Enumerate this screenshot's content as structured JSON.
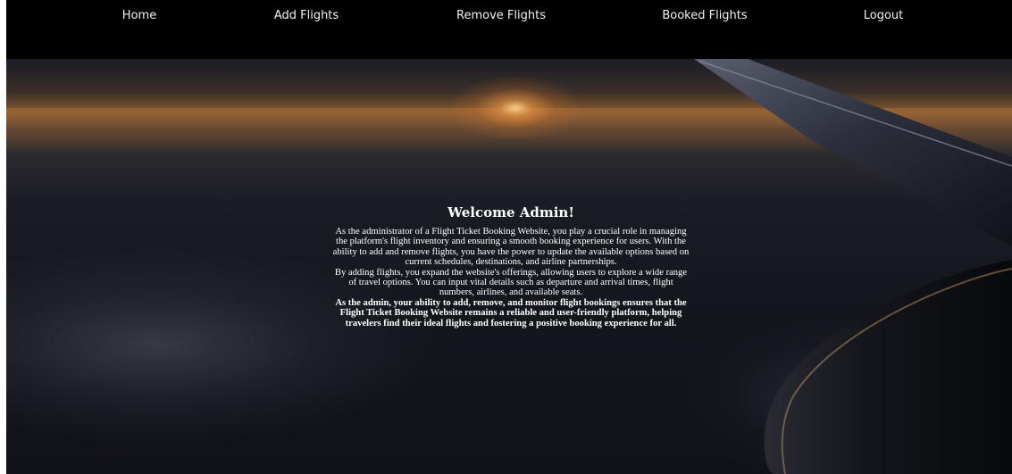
{
  "navbar": {
    "items": [
      {
        "label": "Home"
      },
      {
        "label": "Add Flights"
      },
      {
        "label": "Remove Flights"
      },
      {
        "label": "Booked Flights"
      },
      {
        "label": "Logout"
      }
    ]
  },
  "main": {
    "title": "Welcome Admin!",
    "paragraph_1": "As the administrator of a Flight Ticket Booking Website, you play a crucial role in managing the platform's flight inventory and ensuring a smooth booking experience for users. With the ability to add and remove flights, you have the power to update the available options based on current schedules, destinations, and airline partnerships.",
    "paragraph_2": "By adding flights, you expand the website's offerings, allowing users to explore a wide range of travel options. You can input vital details such as departure and arrival times, flight numbers, airlines, and available seats.",
    "paragraph_3": "As the admin, your ability to add, remove, and monitor flight bookings ensures that the Flight Ticket Booking Website remains a reliable and user-friendly platform, helping travelers find their ideal flights and fostering a positive booking experience for all."
  },
  "colors": {
    "navbar_bg": "#000000",
    "nav_text": "#f2f2f2",
    "body_text": "#ffffff",
    "sunset_accent": "#c07a35"
  },
  "icons": {
    "background": "airplane-wing-sunset-photo"
  }
}
